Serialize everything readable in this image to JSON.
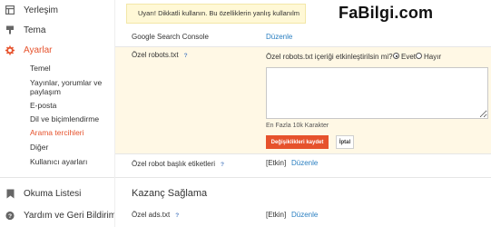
{
  "sidebar": {
    "items": [
      {
        "label": "Yerleşim",
        "icon": "layout-icon"
      },
      {
        "label": "Tema",
        "icon": "theme-icon"
      },
      {
        "label": "Ayarlar",
        "icon": "gear-icon"
      }
    ],
    "sub_items": [
      {
        "label": "Temel"
      },
      {
        "label": "Yayınlar, yorumlar ve paylaşım"
      },
      {
        "label": "E-posta"
      },
      {
        "label": "Dil ve biçimlendirme"
      },
      {
        "label": "Arama tercihleri"
      },
      {
        "label": "Diğer"
      },
      {
        "label": "Kullanıcı ayarları"
      }
    ],
    "bottom_items": [
      {
        "label": "Okuma Listesi",
        "icon": "bookmark-icon"
      },
      {
        "label": "Yardım ve Geri Bildirim",
        "icon": "help-icon"
      }
    ]
  },
  "warning_text": "Uyarı! Dikkatli kullanın. Bu özelliklerin yanlış kullanılm",
  "watermark": "FaBilgi.com",
  "rows": {
    "gsc": {
      "label": "Google Search Console",
      "link": "Düzenle"
    },
    "robots": {
      "label": "Özel robots.txt",
      "help": "?",
      "question": "Özel robots.txt içeriği etkinleştirilsin mi?",
      "option_yes": "Evet",
      "option_no": "Hayır",
      "textarea_value": "",
      "limit": "En Fazla 10k Karakter",
      "save_label": "Değişiklikleri kaydet",
      "cancel_label": "İptal"
    },
    "header_tags": {
      "label": "Özel robot başlık etiketleri",
      "help": "?",
      "status": "[Etkin]",
      "link": "Düzenle"
    }
  },
  "monetization": {
    "title": "Kazanç Sağlama",
    "ads": {
      "label": "Özel ads.txt",
      "help": "?",
      "status": "[Etkin]",
      "link": "Düzenle"
    }
  },
  "colors": {
    "accent": "#e6522c",
    "link": "#2a7fc1",
    "panel": "#fff8e5"
  }
}
